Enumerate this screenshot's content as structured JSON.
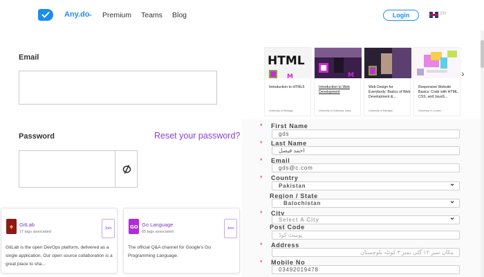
{
  "nav": {
    "brand": "Any.do",
    "links": [
      "Premium",
      "Teams",
      "Blog"
    ],
    "login": "Login",
    "lang": "EN"
  },
  "login_form": {
    "email_label": "Email",
    "password_label": "Password",
    "reset_link": "Reset your password?"
  },
  "tags": [
    {
      "name": "GitLab",
      "count": "17 tags associated",
      "join": "Join",
      "desc": "GitLab is the open DevOps platform, delivered as a single application. Our open source collaboration is a great place to sha...",
      "color": "#8b1a1a"
    },
    {
      "name": "Go Language",
      "count": "65 tags associated",
      "join": "Join",
      "desc": "The official Q&A channel for Google's Go Programming Language.",
      "color": "#b02cd8"
    }
  ],
  "courses": [
    {
      "title": "Introduction to HTML5",
      "uni": "University of Michigan"
    },
    {
      "title": "Introduction to Web Development",
      "uni": "University of California, Davis"
    },
    {
      "title": "Web Design for Everybody: Basics of Web Development &...",
      "uni": "University of Michigan"
    },
    {
      "title": "Responsive Website Basics: Code with HTML, CSS, and JavaS...",
      "uni": "University of London"
    }
  ],
  "reg_form": {
    "first_name": {
      "label": "First Name",
      "value": "gds"
    },
    "last_name": {
      "label": "Last Name",
      "value": "احمد فيصل"
    },
    "email": {
      "label": "Email",
      "value": "gds@c.com"
    },
    "country": {
      "label": "Country",
      "value": "Pakistan"
    },
    "region": {
      "label": "Region / State",
      "value": "Balochistan"
    },
    "city": {
      "label": "City",
      "value": "Select A City"
    },
    "post_code": {
      "label": "Post Code",
      "value": "پوسٹ کوڈ"
    },
    "address": {
      "label": "Address",
      "value": "مکان نمبر ۱۲ گلی نمبر ۳ کوئٹہ بلوچستان"
    },
    "mobile": {
      "label": "Mobile No",
      "value": "03492019478"
    }
  },
  "colors": {
    "accent": "#1a8cf0",
    "link": "#8a3fd1",
    "required": "#e02424"
  }
}
